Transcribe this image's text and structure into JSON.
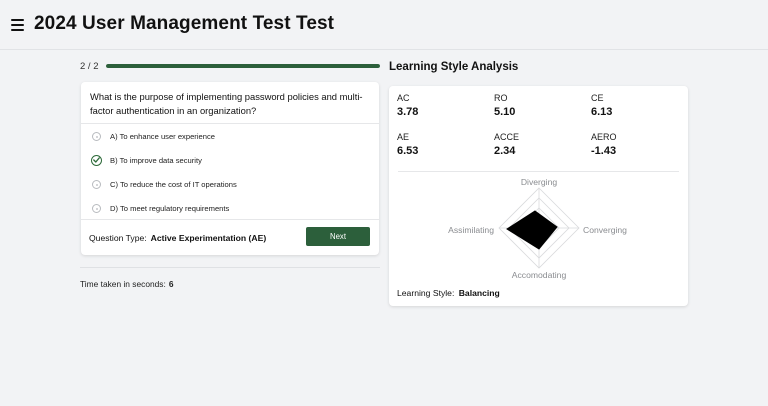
{
  "header": {
    "title": "2024 User Management Test Test",
    "menu_icon": "hamburger-menu-icon"
  },
  "progress": {
    "text": "2 / 2",
    "fraction": 1.0,
    "color": "#2c5f3b"
  },
  "question": {
    "text": "What is the purpose of implementing password policies and multi-factor authentication in an organization?",
    "options": [
      {
        "label": "A) To enhance user experience",
        "selected": false
      },
      {
        "label": "B) To improve data security",
        "selected": true
      },
      {
        "label": "C) To reduce the cost of IT operations",
        "selected": false
      },
      {
        "label": "D) To meet regulatory requirements",
        "selected": false
      }
    ],
    "type_label": "Question Type:",
    "type_value": "Active Experimentation (AE)",
    "next_label": "Next"
  },
  "time": {
    "label": "Time taken in seconds:",
    "value": "6"
  },
  "learning_style": {
    "title": "Learning Style Analysis",
    "metrics": [
      {
        "label": "AC",
        "value": "3.78"
      },
      {
        "label": "RO",
        "value": "5.10"
      },
      {
        "label": "CE",
        "value": "6.13"
      },
      {
        "label": "AE",
        "value": "6.53"
      },
      {
        "label": "ACCE",
        "value": "2.34"
      },
      {
        "label": "AERO",
        "value": "-1.43"
      }
    ],
    "radar": {
      "top": "Diverging",
      "right": "Converging",
      "bottom": "Accomodating",
      "left": "Assimilating"
    },
    "result_label": "Learning Style:",
    "result_value": "Balancing"
  },
  "colors": {
    "accent": "#2c5f3b",
    "background": "#f2f3f5",
    "card": "#ffffff"
  }
}
